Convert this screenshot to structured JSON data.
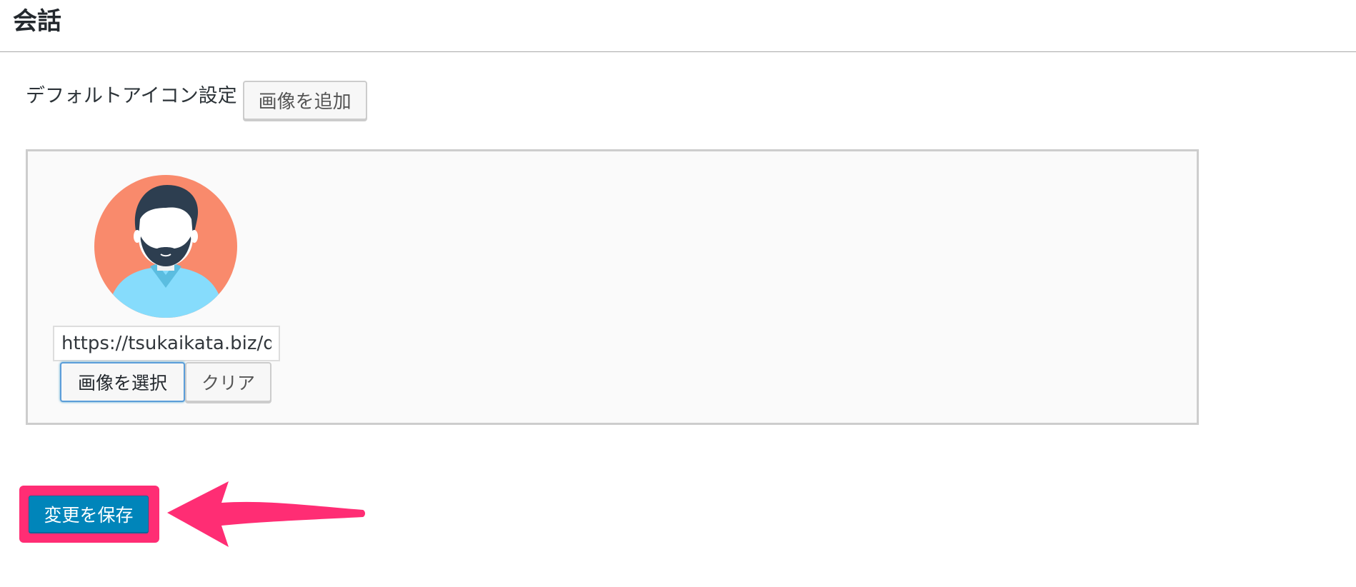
{
  "header": {
    "title": "会話"
  },
  "default_icon": {
    "label": "デフォルトアイコン設定",
    "add_image_label": "画像を追加"
  },
  "icon_item": {
    "avatar_icon": "bearded-man-avatar",
    "url_value": "https://tsukaikata.biz/d",
    "select_image_label": "画像を選択",
    "clear_label": "クリア"
  },
  "footer": {
    "save_label": "変更を保存"
  },
  "colors": {
    "avatar_background": "#f98a6c",
    "shirt": "#86dcfc",
    "hair": "#2d3e50",
    "save_button": "#0085ba",
    "highlight": "#ff2d74"
  }
}
